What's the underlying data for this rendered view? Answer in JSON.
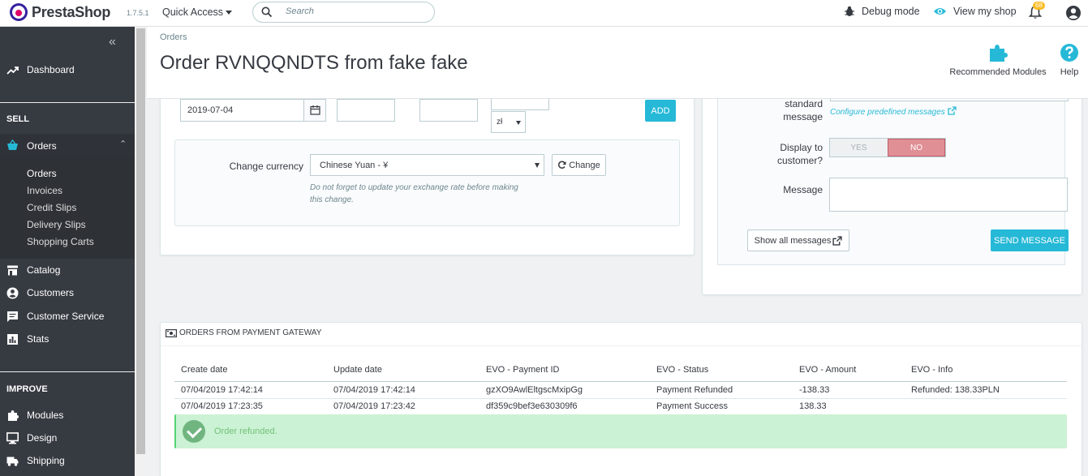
{
  "topbar": {
    "brand": "PrestaShop",
    "version": "1.7.5.1",
    "quick_access": "Quick Access",
    "search_placeholder": "Search",
    "debug_mode": "Debug mode",
    "view_shop": "View my shop",
    "notifications_count": "68"
  },
  "sidebar": {
    "dashboard": "Dashboard",
    "sell_title": "SELL",
    "orders": "Orders",
    "submenu": [
      "Orders",
      "Invoices",
      "Credit Slips",
      "Delivery Slips",
      "Shopping Carts"
    ],
    "catalog": "Catalog",
    "customers": "Customers",
    "customer_service": "Customer Service",
    "stats": "Stats",
    "improve_title": "IMPROVE",
    "modules": "Modules",
    "design": "Design",
    "shipping": "Shipping"
  },
  "header": {
    "breadcrumb": "Orders",
    "title": "Order RVNQQNDTS from fake fake",
    "recommended_modules": "Recommended Modules",
    "help": "Help"
  },
  "discount_form": {
    "date_value": "2019-07-04",
    "currency_symbol": "zł",
    "add_button": "ADD",
    "change_currency_label": "Change currency",
    "currency_selected": "Chinese Yuan - ¥",
    "change_button": "Change",
    "help_text_1": "Do not forget to update your exchange rate before making",
    "help_text_2": "this change."
  },
  "message_form": {
    "standard_message_label_1": "standard",
    "standard_message_label_2": "message",
    "configure_link": "Configure predefined messages",
    "display_label_1": "Display to",
    "display_label_2": "customer?",
    "yes": "YES",
    "no": "NO",
    "message_label": "Message",
    "show_all_button": "Show all messages",
    "send_button": "SEND MESSAGE"
  },
  "gateway": {
    "title": "ORDERS FROM PAYMENT GATEWAY",
    "columns": [
      "Create date",
      "Update date",
      "EVO - Payment ID",
      "EVO - Status",
      "EVO - Amount",
      "EVO - Info"
    ],
    "rows": [
      [
        "07/04/2019 17:42:14",
        "07/04/2019 17:42:14",
        "gzXO9AwlEltgscMxipGg",
        "Payment Refunded",
        "-138.33",
        "Refunded: 138.33PLN"
      ],
      [
        "07/04/2019 17:23:35",
        "07/04/2019 17:23:42",
        "df359c9bef3e630309f6",
        "Payment Success",
        "138.33",
        ""
      ]
    ],
    "alert": "Order refunded."
  },
  "colors": {
    "primary": "#25b9d7",
    "sidebar_bg": "#363a41",
    "danger_toggle": "#e08f95",
    "success_bg": "#cbf2d4"
  }
}
